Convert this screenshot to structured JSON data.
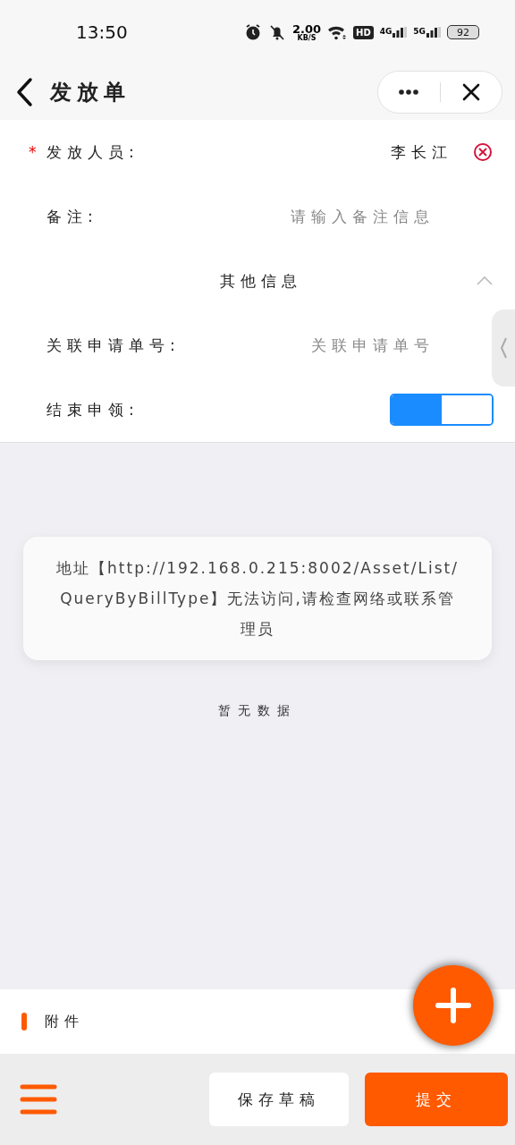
{
  "status_bar": {
    "time": "13:50",
    "speed_value": "2.00",
    "speed_unit": "KB/S",
    "hd_badge": "HD",
    "network_4g": "4G",
    "network_5g": "5G",
    "battery": "92"
  },
  "header": {
    "title": "发放单"
  },
  "form": {
    "rows": [
      {
        "kind": "select",
        "label": "发放人员:",
        "required": true,
        "required_mark": "*",
        "value": "李长江"
      },
      {
        "kind": "input",
        "label": "备注:",
        "placeholder": "请输入备注信息"
      },
      {
        "kind": "section",
        "title": "其他信息",
        "expanded": true
      },
      {
        "kind": "input",
        "label": "关联申请单号:",
        "placeholder": "关联申请单号"
      },
      {
        "kind": "switch",
        "label": "结束申领:",
        "on": true
      }
    ]
  },
  "notice": {
    "message": "地址【http://192.168.0.215:8002/Asset/List/QueryByBillType】无法访问,请检查网络或联系管理员"
  },
  "empty_text": "暂无数据",
  "attachments": {
    "title": "附件"
  },
  "bottom_bar": {
    "buttons": [
      {
        "kind": "secondary",
        "label": "保存草稿"
      },
      {
        "kind": "primary",
        "label": "提交"
      }
    ]
  }
}
